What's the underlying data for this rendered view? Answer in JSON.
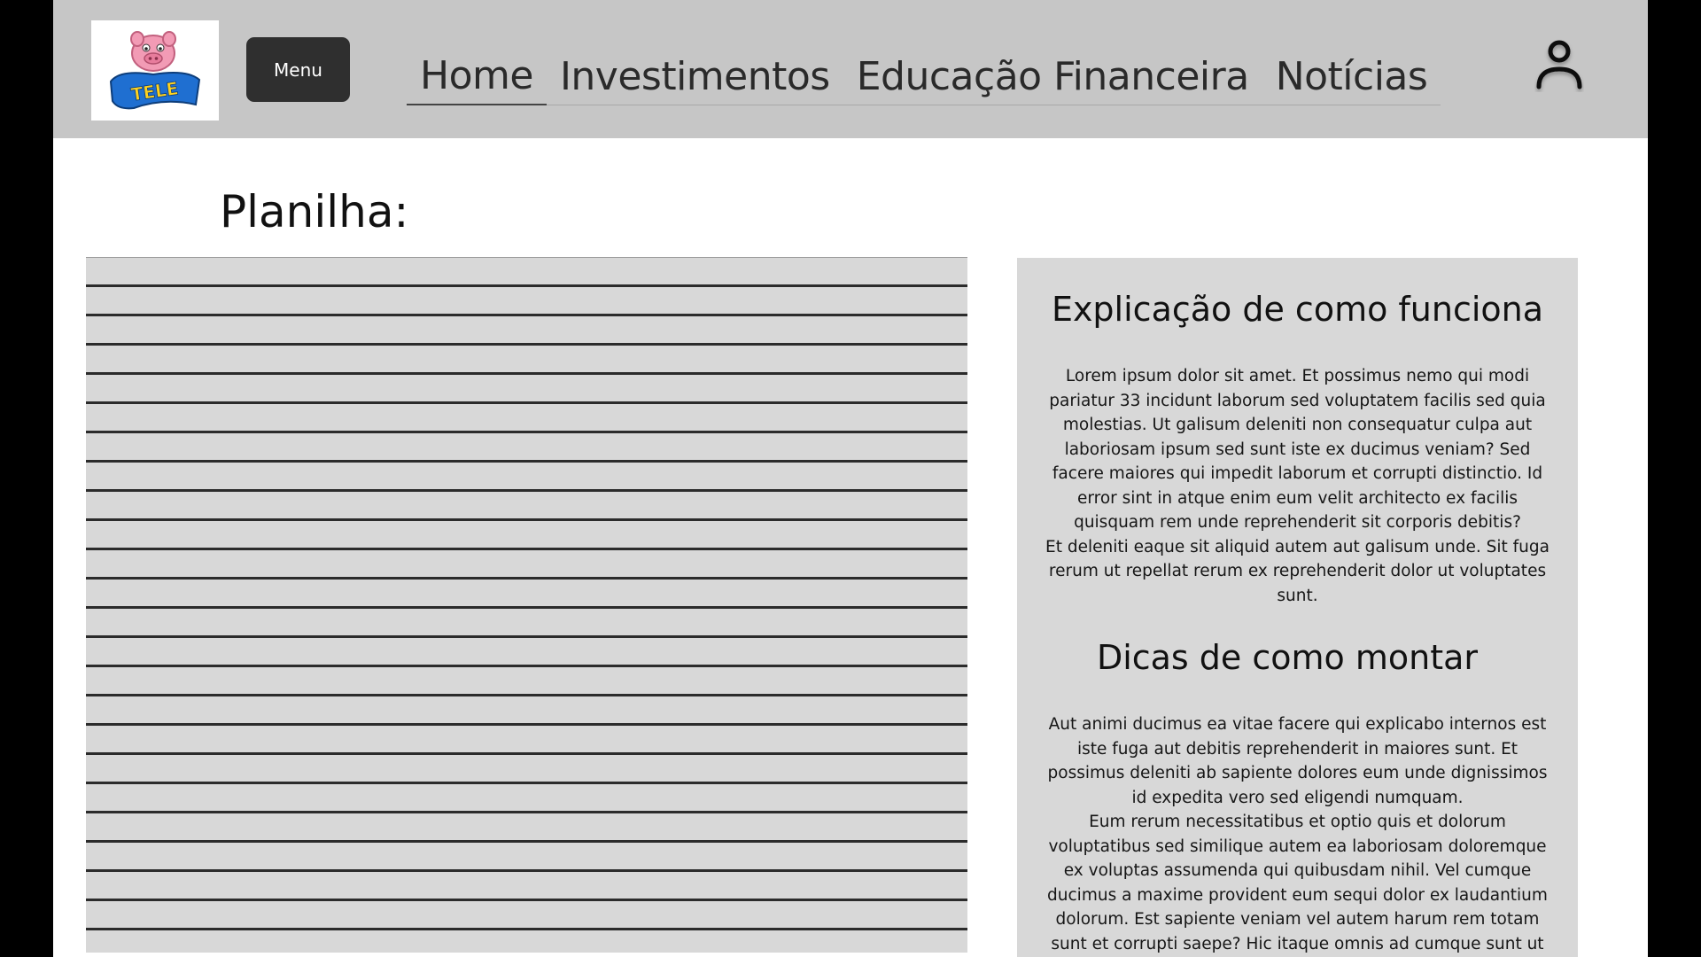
{
  "header": {
    "logo_alt": "TELE SENA",
    "menu_label": "Menu",
    "nav": [
      {
        "label": "Home",
        "active": true
      },
      {
        "label": "Investimentos",
        "active": false
      },
      {
        "label": "Educação Financeira",
        "active": false
      },
      {
        "label": "Notícias",
        "active": false
      }
    ],
    "user_icon": "user-icon"
  },
  "main": {
    "title": "Planilha:"
  },
  "side_panel": {
    "heading1": "Explicação de como funciona",
    "para1": "Lorem ipsum dolor sit amet. Et possimus nemo qui modi pariatur 33 incidunt laborum sed voluptatem facilis sed quia molestias. Ut galisum deleniti non consequatur culpa aut laboriosam ipsum sed sunt iste ex ducimus veniam? Sed facere maiores qui impedit laborum et corrupti distinctio. Id error sint in atque enim eum velit architecto ex facilis quisquam rem unde reprehenderit sit corporis debitis?\nEt deleniti eaque sit aliquid autem aut galisum unde. Sit fuga rerum ut repellat rerum ex reprehenderit dolor ut voluptates sunt.",
    "heading2": "Dicas de como montar",
    "para2": "Aut animi ducimus ea vitae facere qui explicabo internos est iste fuga aut debitis reprehenderit in maiores sunt. Et possimus deleniti ab sapiente dolores eum unde dignissimos id expedita vero sed eligendi numquam.\nEum rerum necessitatibus et optio quis et dolorum voluptatibus sed similique autem ea laboriosam doloremque ex voluptas assumenda qui quibusdam nihil. Vel cumque ducimus a maxime provident eum sequi dolor ex laudantium dolorum. Est sapiente veniam vel autem harum rem totam sunt et corrupti saepe? Hic itaque omnis ad cumque sunt ut"
  },
  "colors": {
    "header_bg": "#c6c6c6",
    "panel_bg": "#d8d8d8",
    "menu_button": "#2f2f2f",
    "outer_bg": "#000000"
  }
}
